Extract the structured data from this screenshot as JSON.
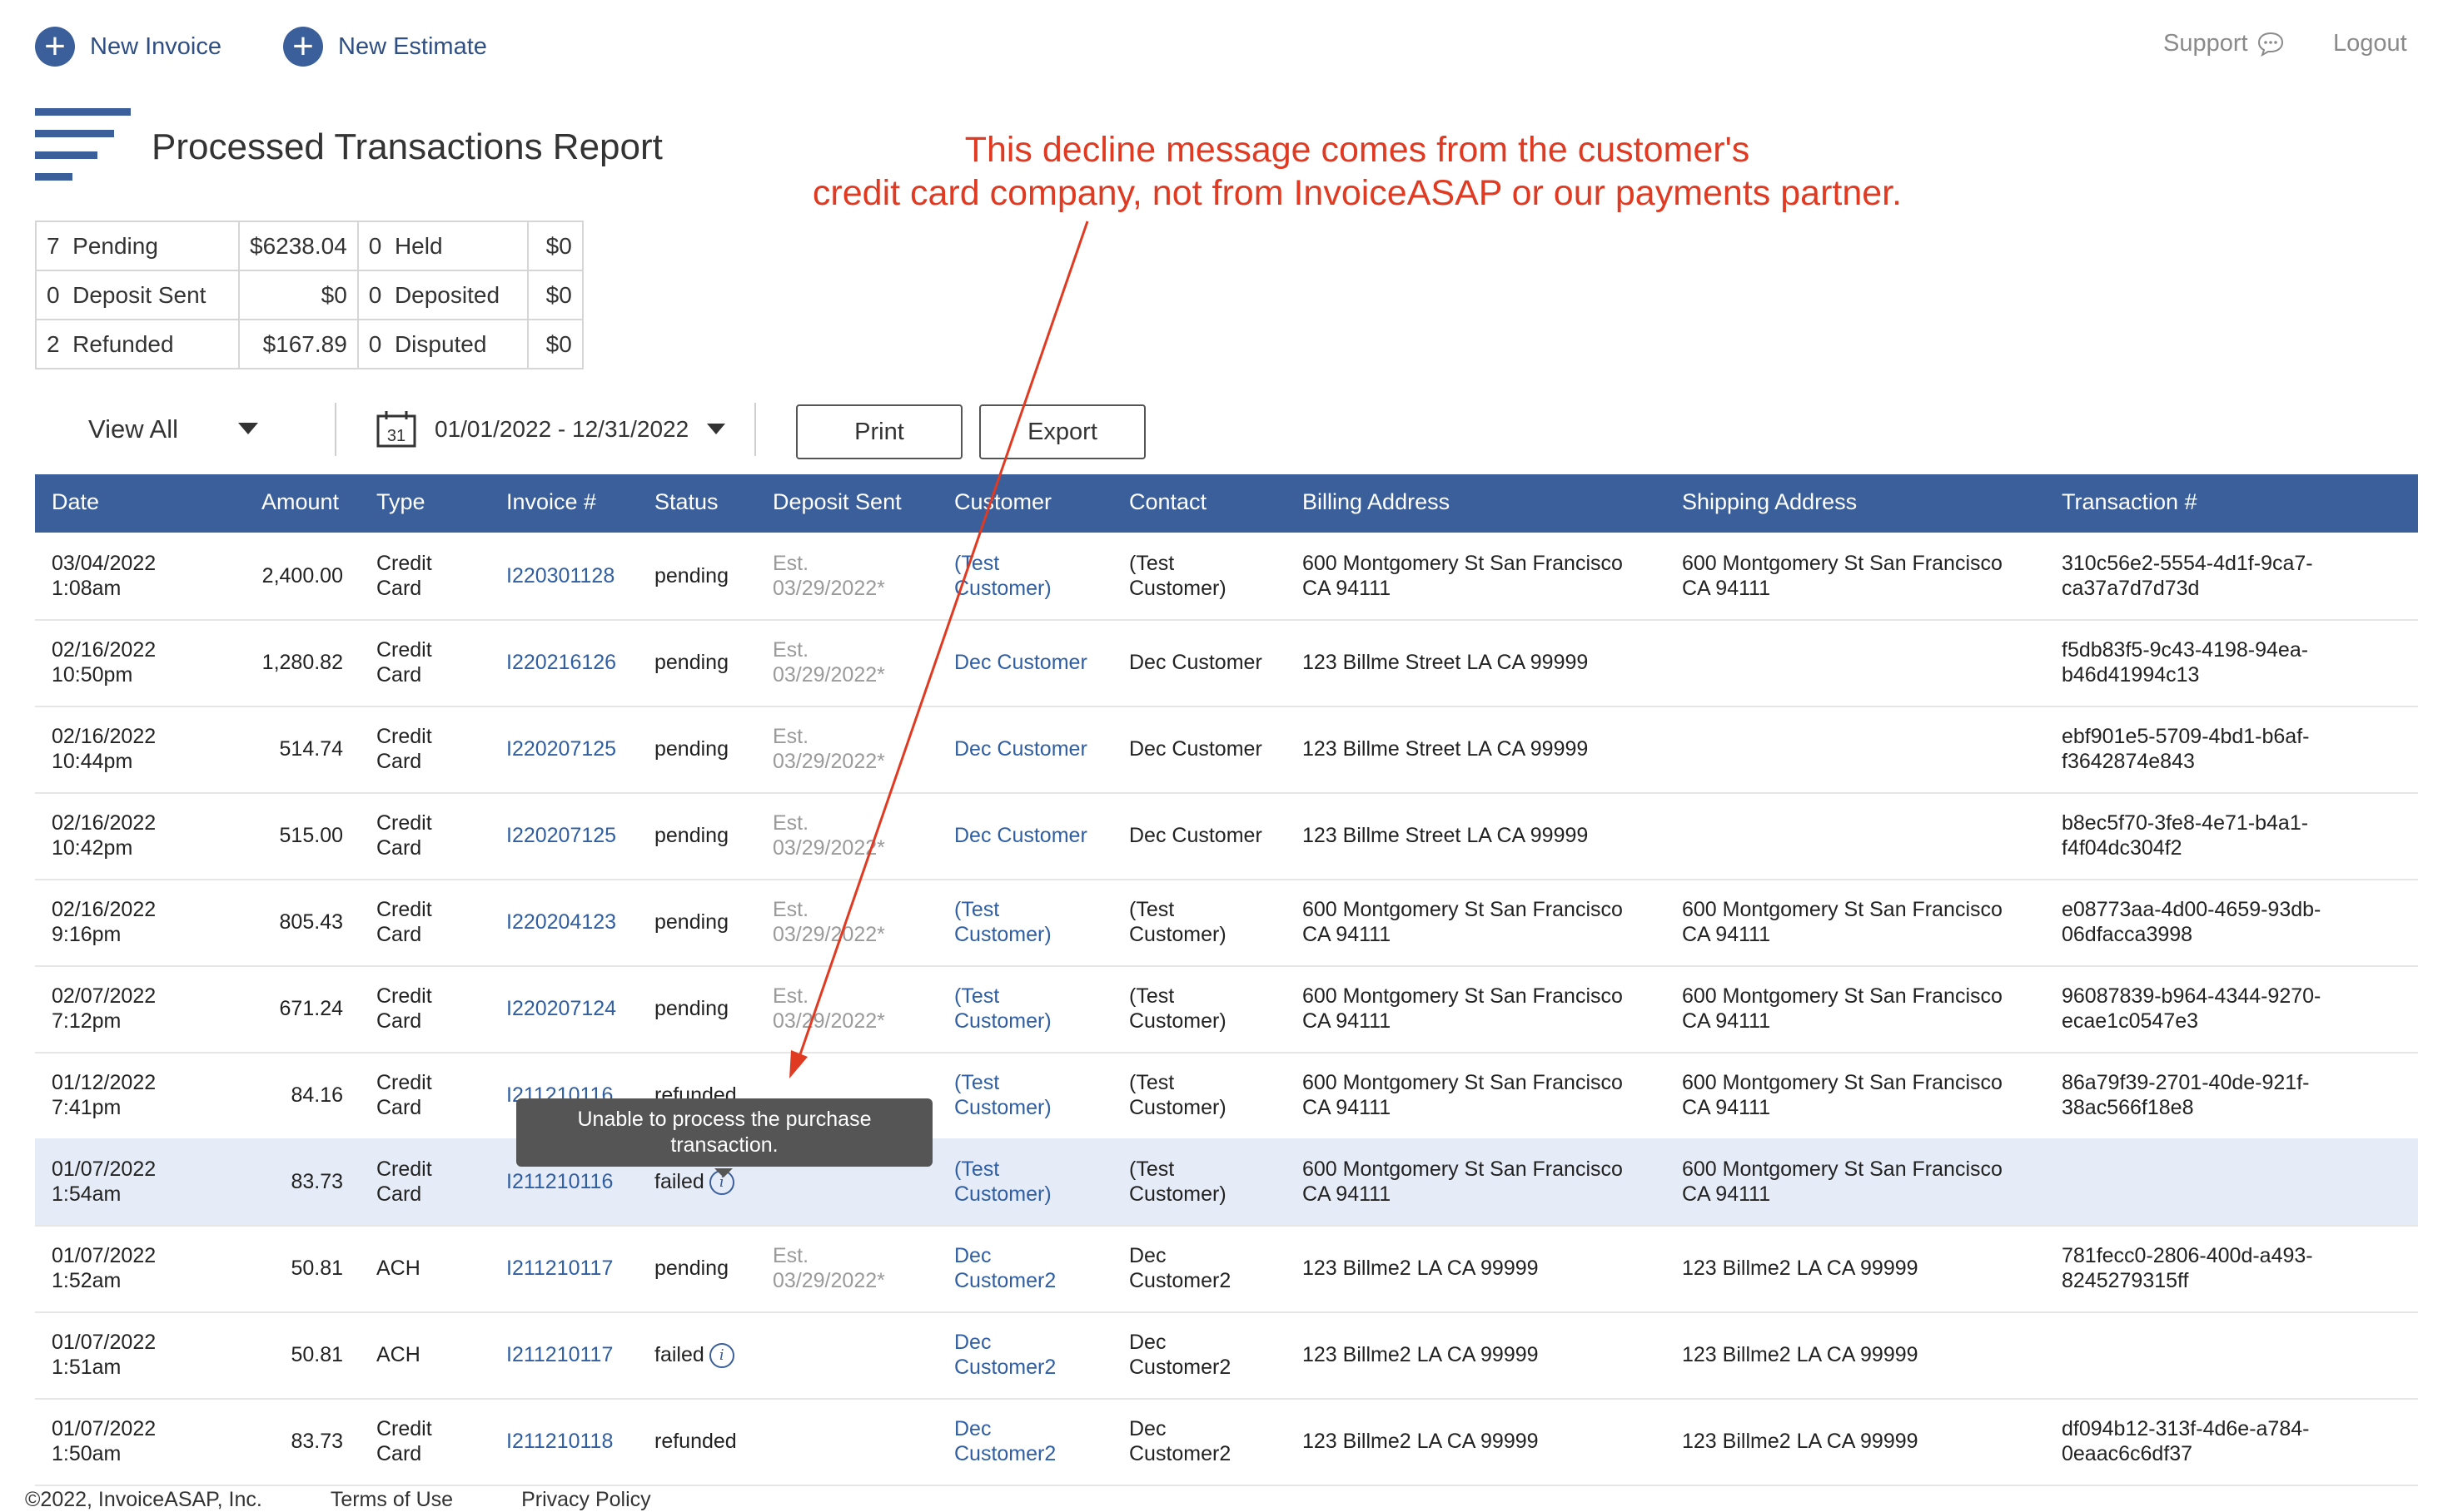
{
  "top": {
    "new_invoice": "New Invoice",
    "new_estimate": "New Estimate",
    "support": "Support",
    "logout": "Logout"
  },
  "page_title": "Processed Transactions Report",
  "summary": [
    [
      {
        "count": "7",
        "label": "Pending",
        "amount": "$6238.04"
      },
      {
        "count": "0",
        "label": "Held",
        "amount": "$0"
      }
    ],
    [
      {
        "count": "0",
        "label": "Deposit Sent",
        "amount": "$0"
      },
      {
        "count": "0",
        "label": "Deposited",
        "amount": "$0"
      }
    ],
    [
      {
        "count": "2",
        "label": "Refunded",
        "amount": "$167.89"
      },
      {
        "count": "0",
        "label": "Disputed",
        "amount": "$0"
      }
    ]
  ],
  "controls": {
    "view_filter": "View All",
    "date_range": "01/01/2022 - 12/31/2022",
    "calendar_day": "31",
    "print": "Print",
    "export": "Export"
  },
  "columns": [
    "Date",
    "Amount",
    "Type",
    "Invoice #",
    "Status",
    "Deposit Sent",
    "Customer",
    "Contact",
    "Billing Address",
    "Shipping Address",
    "Transaction #"
  ],
  "rows": [
    {
      "date": "03/04/2022",
      "time": "1:08am",
      "amount": "2,400.00",
      "type1": "Credit",
      "type2": "Card",
      "invoice": "I220301128",
      "status": "pending",
      "dep1": "Est.",
      "dep2": "03/29/2022*",
      "cust1": "(Test",
      "cust2": "Customer)",
      "contact1": "(Test",
      "contact2": "Customer)",
      "bill1": "600 Montgomery St San Francisco",
      "bill2": "CA 94111",
      "ship1": "600 Montgomery St San Francisco",
      "ship2": "CA 94111",
      "tx1": "310c56e2-5554-4d1f-9ca7-",
      "tx2": "ca37a7d7d73d"
    },
    {
      "date": "02/16/2022",
      "time": "10:50pm",
      "amount": "1,280.82",
      "type1": "Credit",
      "type2": "Card",
      "invoice": "I220216126",
      "status": "pending",
      "dep1": "Est.",
      "dep2": "03/29/2022*",
      "cust1": "Dec Customer",
      "cust2": "",
      "contact1": "Dec Customer",
      "contact2": "",
      "bill1": "123 Billme Street LA CA 99999",
      "bill2": "",
      "ship1": "",
      "ship2": "",
      "tx1": "f5db83f5-9c43-4198-94ea-",
      "tx2": "b46d41994c13"
    },
    {
      "date": "02/16/2022",
      "time": "10:44pm",
      "amount": "514.74",
      "type1": "Credit",
      "type2": "Card",
      "invoice": "I220207125",
      "status": "pending",
      "dep1": "Est.",
      "dep2": "03/29/2022*",
      "cust1": "Dec Customer",
      "cust2": "",
      "contact1": "Dec Customer",
      "contact2": "",
      "bill1": "123 Billme Street LA CA 99999",
      "bill2": "",
      "ship1": "",
      "ship2": "",
      "tx1": "ebf901e5-5709-4bd1-b6af-",
      "tx2": "f3642874e843"
    },
    {
      "date": "02/16/2022",
      "time": "10:42pm",
      "amount": "515.00",
      "type1": "Credit",
      "type2": "Card",
      "invoice": "I220207125",
      "status": "pending",
      "dep1": "Est.",
      "dep2": "03/29/2022*",
      "cust1": "Dec Customer",
      "cust2": "",
      "contact1": "Dec Customer",
      "contact2": "",
      "bill1": "123 Billme Street LA CA 99999",
      "bill2": "",
      "ship1": "",
      "ship2": "",
      "tx1": "b8ec5f70-3fe8-4e71-b4a1-",
      "tx2": "f4f04dc304f2"
    },
    {
      "date": "02/16/2022",
      "time": "9:16pm",
      "amount": "805.43",
      "type1": "Credit",
      "type2": "Card",
      "invoice": "I220204123",
      "status": "pending",
      "dep1": "Est.",
      "dep2": "03/29/2022*",
      "cust1": "(Test",
      "cust2": "Customer)",
      "contact1": "(Test",
      "contact2": "Customer)",
      "bill1": "600 Montgomery St San Francisco",
      "bill2": "CA 94111",
      "ship1": "600 Montgomery St San Francisco",
      "ship2": "CA 94111",
      "tx1": "e08773aa-4d00-4659-93db-",
      "tx2": "06dfacca3998"
    },
    {
      "date": "02/07/2022",
      "time": "7:12pm",
      "amount": "671.24",
      "type1": "Credit",
      "type2": "Card",
      "invoice": "I220207124",
      "status": "pending",
      "dep1": "Est.",
      "dep2": "03/29/2022*",
      "cust1": "(Test",
      "cust2": "Customer)",
      "contact1": "(Test",
      "contact2": "Customer)",
      "bill1": "600 Montgomery St San Francisco",
      "bill2": "CA 94111",
      "ship1": "600 Montgomery St San Francisco",
      "ship2": "CA 94111",
      "tx1": "96087839-b964-4344-9270-",
      "tx2": "ecae1c0547e3"
    },
    {
      "date": "01/12/2022",
      "time": "7:41pm",
      "amount": "84.16",
      "type1": "Credit",
      "type2": "Card",
      "invoice": "I211210116",
      "status": "refunded",
      "dep1": "",
      "dep2": "",
      "cust1": "(Test",
      "cust2": "Customer)",
      "contact1": "(Test",
      "contact2": "Customer)",
      "bill1": "600 Montgomery St San Francisco",
      "bill2": "CA 94111",
      "ship1": "600 Montgomery St San Francisco",
      "ship2": "CA 94111",
      "tx1": "86a79f39-2701-40de-921f-",
      "tx2": "38ac566f18e8"
    },
    {
      "date": "01/07/2022",
      "time": "1:54am",
      "amount": "83.73",
      "type1": "Credit",
      "type2": "Card",
      "invoice": "I211210116",
      "status": "failed",
      "dep1": "",
      "dep2": "",
      "cust1": "(Test",
      "cust2": "Customer)",
      "contact1": "(Test",
      "contact2": "Customer)",
      "bill1": "600 Montgomery St San Francisco",
      "bill2": "CA 94111",
      "ship1": "600 Montgomery St San Francisco",
      "ship2": "CA 94111",
      "tx1": "",
      "tx2": ""
    },
    {
      "date": "01/07/2022",
      "time": "1:52am",
      "amount": "50.81",
      "type1": "ACH",
      "type2": "",
      "invoice": "I211210117",
      "status": "pending",
      "dep1": "Est.",
      "dep2": "03/29/2022*",
      "cust1": "Dec",
      "cust2": "Customer2",
      "contact1": "Dec",
      "contact2": "Customer2",
      "bill1": "123 Billme2 LA CA 99999",
      "bill2": "",
      "ship1": "123 Billme2 LA CA 99999",
      "ship2": "",
      "tx1": "781fecc0-2806-400d-a493-",
      "tx2": "8245279315ff"
    },
    {
      "date": "01/07/2022",
      "time": "1:51am",
      "amount": "50.81",
      "type1": "ACH",
      "type2": "",
      "invoice": "I211210117",
      "status": "failed",
      "dep1": "",
      "dep2": "",
      "cust1": "Dec",
      "cust2": "Customer2",
      "contact1": "Dec",
      "contact2": "Customer2",
      "bill1": "123 Billme2 LA CA 99999",
      "bill2": "",
      "ship1": "123 Billme2 LA CA 99999",
      "ship2": "",
      "tx1": "",
      "tx2": ""
    },
    {
      "date": "01/07/2022",
      "time": "1:50am",
      "amount": "83.73",
      "type1": "Credit",
      "type2": "Card",
      "invoice": "I211210118",
      "status": "refunded",
      "dep1": "",
      "dep2": "",
      "cust1": "Dec",
      "cust2": "Customer2",
      "contact1": "Dec",
      "contact2": "Customer2",
      "bill1": "123 Billme2 LA CA 99999",
      "bill2": "",
      "ship1": "123 Billme2 LA CA 99999",
      "ship2": "",
      "tx1": "df094b12-313f-4d6e-a784-",
      "tx2": "0eaac6c6df37"
    }
  ],
  "tooltip": {
    "line1": "Unable to process the purchase",
    "line2": "transaction."
  },
  "annotation": {
    "line1": "This decline message comes from the customer's",
    "line2": "credit card company, not from InvoiceASAP or our payments partner."
  },
  "footer": {
    "copyright": "©2022, InvoiceASAP, Inc.",
    "terms": "Terms of Use",
    "privacy": "Privacy Policy"
  },
  "colors": {
    "header_bg": "#3a5f9a",
    "link": "#2f5ea3",
    "annotation": "#e03a22",
    "highlight_row": "#e6ecf7",
    "tooltip_bg": "#555555"
  }
}
